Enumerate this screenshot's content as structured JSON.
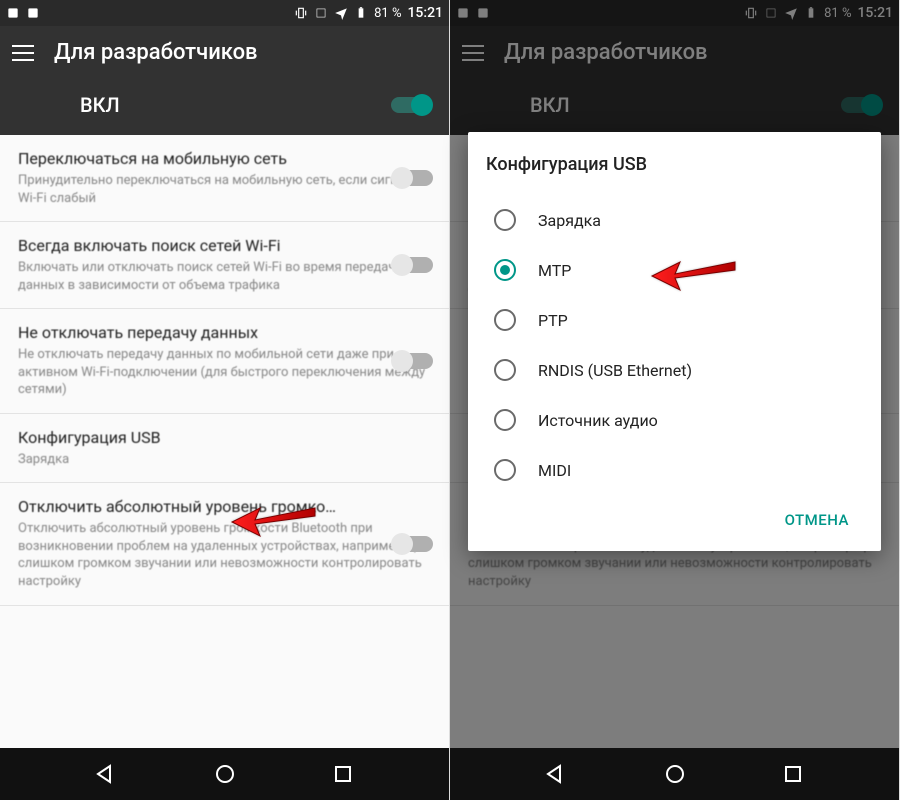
{
  "statusbar": {
    "battery": "81 %",
    "time": "15:21"
  },
  "appbar": {
    "title": "Для разработчиков"
  },
  "master_toggle": {
    "label": "ВКЛ"
  },
  "settings": [
    {
      "title": "Переключаться на мобильную сеть",
      "subtitle": "Принудительно переключаться на мобильную сеть, если сигнал Wi-Fi слабый",
      "has_switch": true
    },
    {
      "title": "Всегда включать поиск сетей Wi-Fi",
      "subtitle": "Включать или отключать поиск сетей Wi-Fi во время передачи данных в зависимости от объема трафика",
      "has_switch": true
    },
    {
      "title": "Не отключать передачу данных",
      "subtitle": "Не отключать передачу данных по мобильной сети даже при активном Wi-Fi-подключении (для быстрого переключения между сетями)",
      "has_switch": true
    },
    {
      "title": "Конфигурация USB",
      "subtitle": "Зарядка",
      "has_switch": false
    },
    {
      "title": "Отключить абсолютный уровень громко…",
      "subtitle": "Отключить абсолютный уровень громкости Bluetooth при возникновении проблем на удаленных устройствах, например при слишком громком звучании или невозможности контролировать настройку",
      "has_switch": true
    }
  ],
  "dialog": {
    "title": "Конфигурация USB",
    "options": [
      {
        "label": "Зарядка",
        "selected": false
      },
      {
        "label": "MTP",
        "selected": true
      },
      {
        "label": "PTP",
        "selected": false
      },
      {
        "label": "RNDIS (USB Ethernet)",
        "selected": false
      },
      {
        "label": "Источник аудио",
        "selected": false
      },
      {
        "label": "MIDI",
        "selected": false
      }
    ],
    "cancel": "ОТМЕНА"
  }
}
